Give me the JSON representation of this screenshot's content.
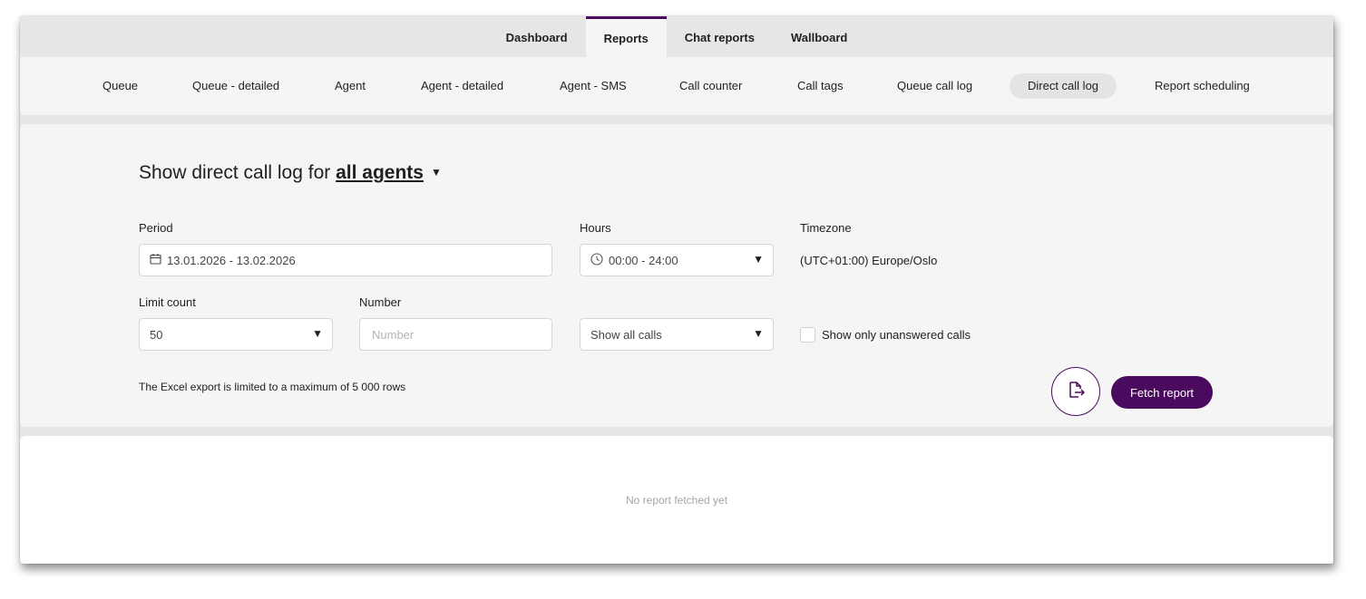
{
  "top_tabs": [
    {
      "label": "Dashboard",
      "active": false
    },
    {
      "label": "Reports",
      "active": true
    },
    {
      "label": "Chat reports",
      "active": false
    },
    {
      "label": "Wallboard",
      "active": false
    }
  ],
  "sub_tabs": [
    {
      "label": "Queue"
    },
    {
      "label": "Queue - detailed"
    },
    {
      "label": "Agent"
    },
    {
      "label": "Agent - detailed"
    },
    {
      "label": "Agent - SMS"
    },
    {
      "label": "Call counter"
    },
    {
      "label": "Call tags"
    },
    {
      "label": "Queue call log"
    },
    {
      "label": "Direct call log",
      "active": true
    },
    {
      "label": "Report scheduling"
    }
  ],
  "filter": {
    "title_prefix": "Show direct call log for",
    "title_agents": "all agents",
    "period_label": "Period",
    "period_value": "13.01.2026 - 13.02.2026",
    "hours_label": "Hours",
    "hours_value": "00:00 - 24:00",
    "timezone_label": "Timezone",
    "timezone_value": "(UTC+01:00) Europe/Oslo",
    "limit_label": "Limit count",
    "limit_value": "50",
    "number_label": "Number",
    "number_placeholder": "Number",
    "calls_filter_value": "Show all calls",
    "unanswered_label": "Show only unanswered calls",
    "unanswered_checked": false,
    "export_note": "The Excel export is limited to a maximum of 5 000 rows",
    "fetch_label": "Fetch report"
  },
  "result": {
    "empty_message": "No report fetched yet"
  },
  "colors": {
    "accent": "#4a0a5e",
    "background": "#e6e6e6",
    "panel": "#f5f5f5"
  }
}
